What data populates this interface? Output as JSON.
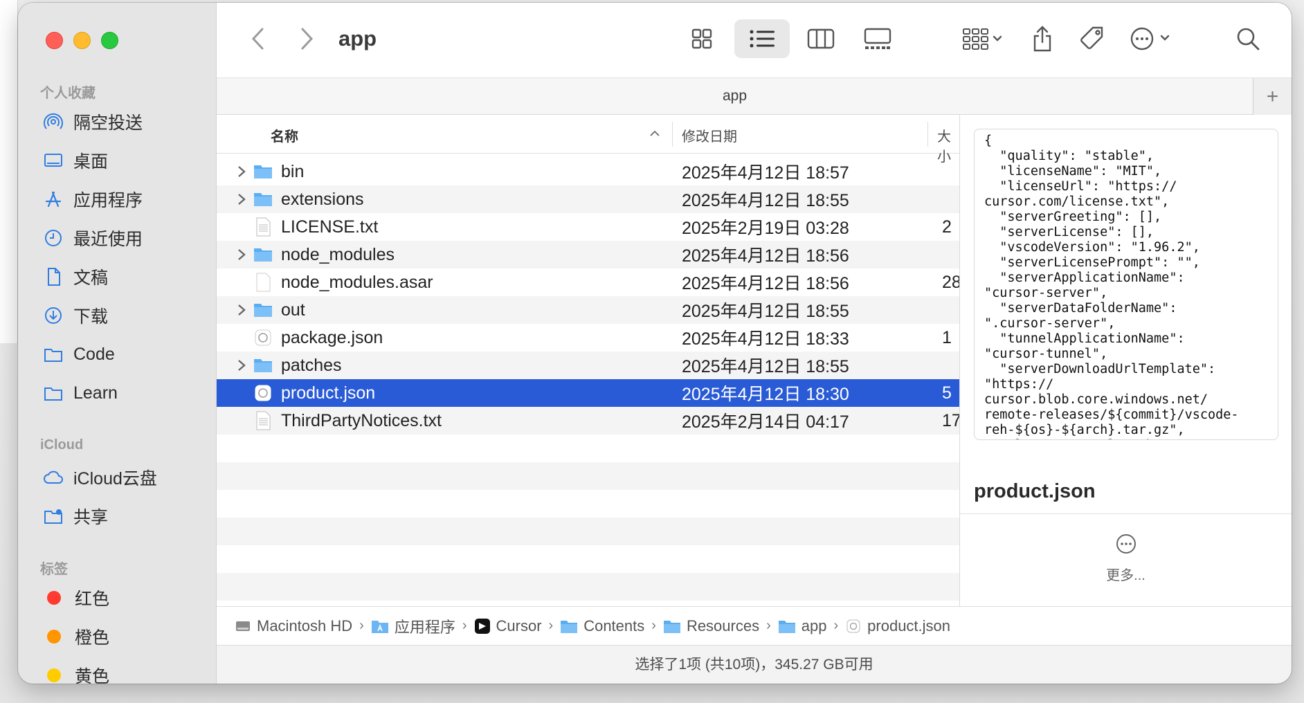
{
  "window": {
    "title": "app",
    "path_label": "app"
  },
  "sidebar": {
    "favorites_title": "个人收藏",
    "favorites": [
      {
        "label": "隔空投送",
        "icon": "airdrop-icon"
      },
      {
        "label": "桌面",
        "icon": "desktop-icon"
      },
      {
        "label": "应用程序",
        "icon": "applications-icon"
      },
      {
        "label": "最近使用",
        "icon": "clock-icon"
      },
      {
        "label": "文稿",
        "icon": "document-icon"
      },
      {
        "label": "下载",
        "icon": "download-icon"
      },
      {
        "label": "Code",
        "icon": "folder-icon"
      },
      {
        "label": "Learn",
        "icon": "folder-icon"
      }
    ],
    "icloud_title": "iCloud",
    "icloud": [
      {
        "label": "iCloud云盘",
        "icon": "cloud-icon"
      },
      {
        "label": "共享",
        "icon": "shared-folder-icon"
      }
    ],
    "tags_title": "标签",
    "tags": [
      {
        "label": "红色",
        "color": "#ff3b30"
      },
      {
        "label": "橙色",
        "color": "#ff9500"
      },
      {
        "label": "黄色",
        "color": "#ffcc00"
      }
    ]
  },
  "columns": {
    "name": "名称",
    "date": "修改日期",
    "size": "大小"
  },
  "files": [
    {
      "name": "bin",
      "date": "2025年4月12日 18:57",
      "size": "",
      "kind": "folder"
    },
    {
      "name": "extensions",
      "date": "2025年4月12日 18:55",
      "size": "",
      "kind": "folder"
    },
    {
      "name": "LICENSE.txt",
      "date": "2025年2月19日 03:28",
      "size": "2",
      "kind": "text"
    },
    {
      "name": "node_modules",
      "date": "2025年4月12日 18:56",
      "size": "",
      "kind": "folder"
    },
    {
      "name": "node_modules.asar",
      "date": "2025年4月12日 18:56",
      "size": "28",
      "kind": "blank"
    },
    {
      "name": "out",
      "date": "2025年4月12日 18:55",
      "size": "",
      "kind": "folder"
    },
    {
      "name": "package.json",
      "date": "2025年4月12日 18:33",
      "size": "1",
      "kind": "json"
    },
    {
      "name": "patches",
      "date": "2025年4月12日 18:55",
      "size": "",
      "kind": "folder"
    },
    {
      "name": "product.json",
      "date": "2025年4月12日 18:30",
      "size": "5",
      "kind": "json",
      "selected": true
    },
    {
      "name": "ThirdPartyNotices.txt",
      "date": "2025年2月14日 04:17",
      "size": "17",
      "kind": "text"
    }
  ],
  "preview": {
    "content": "{\n  \"quality\": \"stable\",\n  \"licenseName\": \"MIT\",\n  \"licenseUrl\": \"https://\ncursor.com/license.txt\",\n  \"serverGreeting\": [],\n  \"serverLicense\": [],\n  \"vscodeVersion\": \"1.96.2\",\n  \"serverLicensePrompt\": \"\",\n  \"serverApplicationName\":\n\"cursor-server\",\n  \"serverDataFolderName\":\n\".cursor-server\",\n  \"tunnelApplicationName\":\n\"cursor-tunnel\",\n  \"serverDownloadUrlTemplate\":\n\"https://\ncursor.blob.core.windows.net/\nremote-releases/${commit}/vscode-\nreh-${os}-${arch}.tar.gz\",\n  \"nlsCoreBaseUrl\": \"https://",
    "filename": "product.json",
    "more_label": "更多..."
  },
  "breadcrumb": [
    {
      "label": "Macintosh HD",
      "icon": "hard-drive-icon"
    },
    {
      "label": "应用程序",
      "icon": "applications-folder-icon"
    },
    {
      "label": "Cursor",
      "icon": "cursor-app-icon"
    },
    {
      "label": "Contents",
      "icon": "folder-icon"
    },
    {
      "label": "Resources",
      "icon": "folder-icon"
    },
    {
      "label": "app",
      "icon": "folder-icon"
    },
    {
      "label": "product.json",
      "icon": "json-file-icon"
    }
  ],
  "status": "选择了1项 (共10项)，345.27 GB可用",
  "colors": {
    "selection": "#2a5bd7",
    "folder": "#5aaef0"
  }
}
